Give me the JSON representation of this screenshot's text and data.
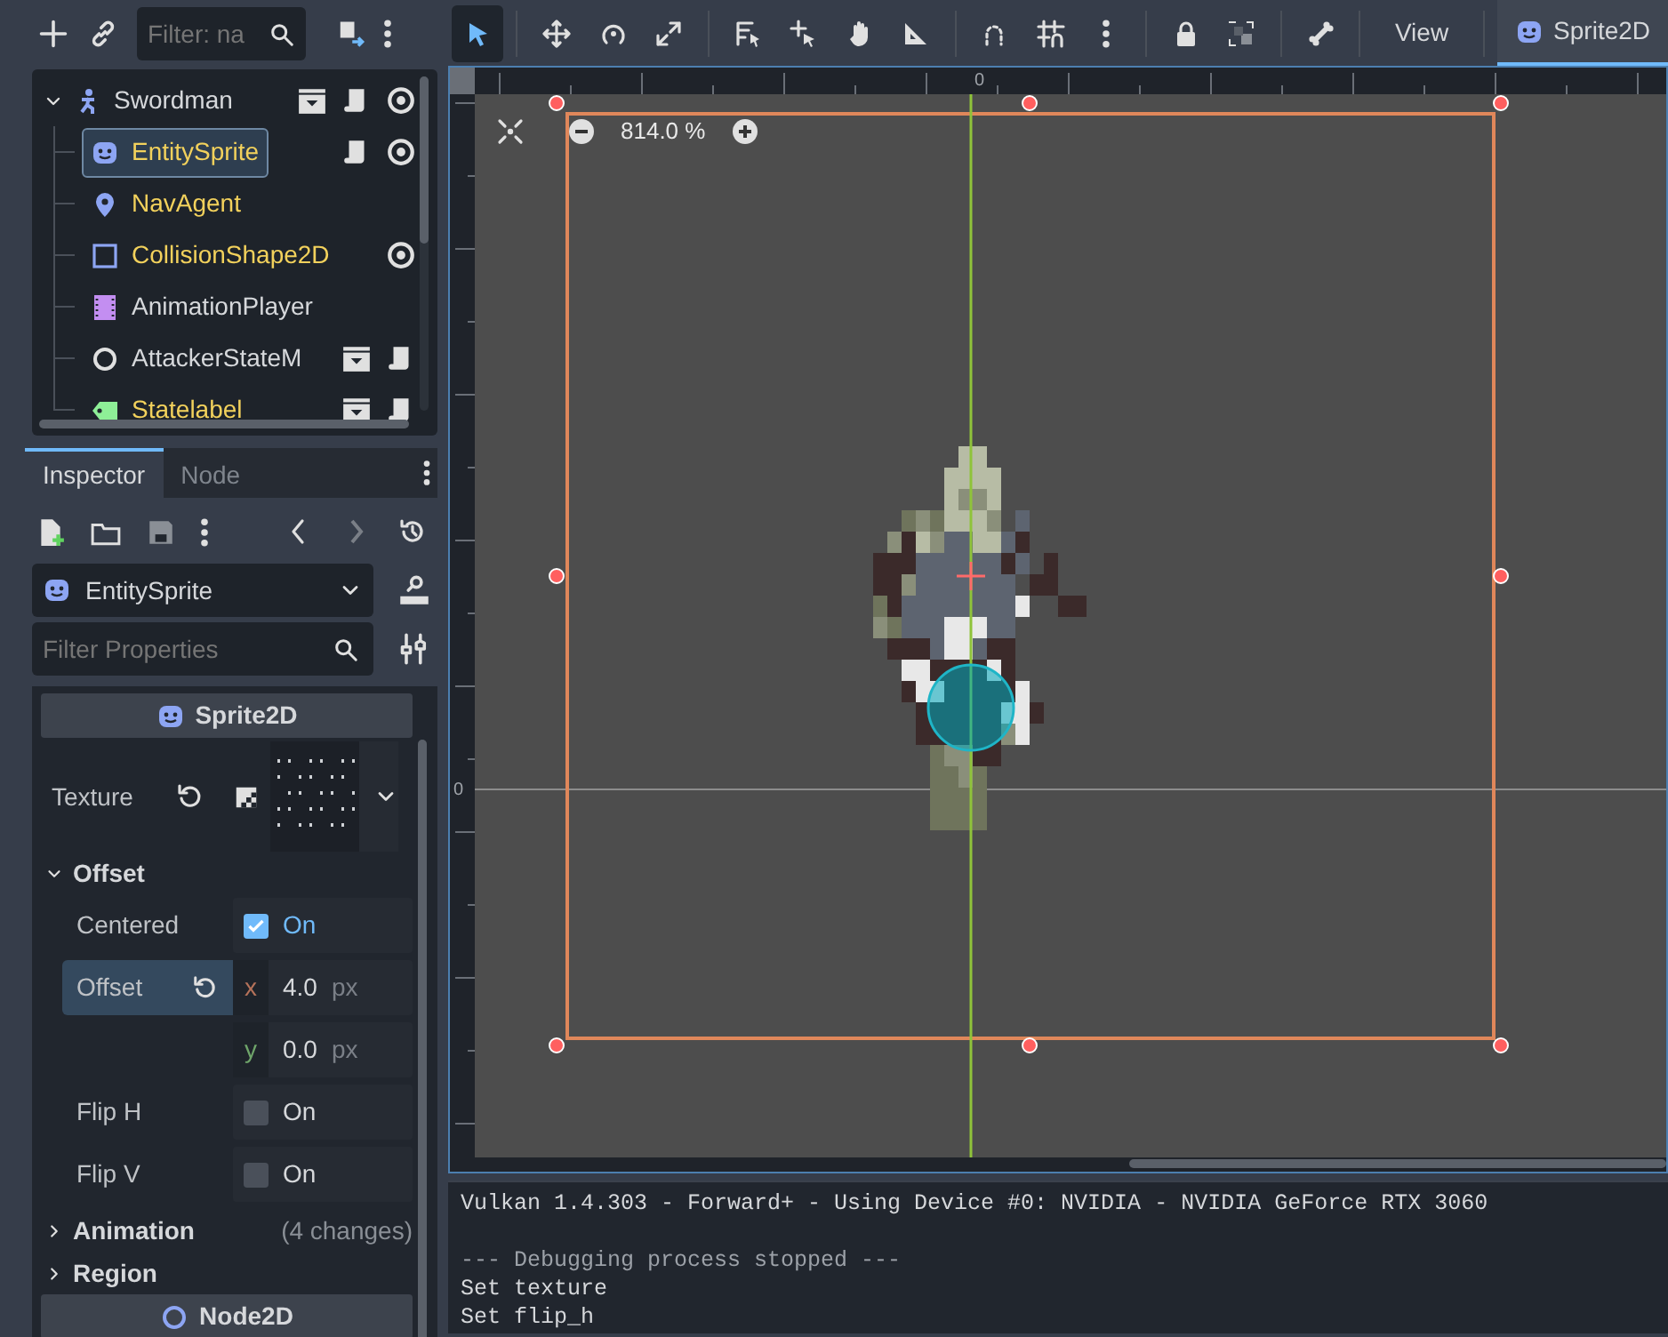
{
  "scene_dock": {
    "filter_placeholder": "Filter: na",
    "tree": {
      "label": "Swordman",
      "expanded": true,
      "selected": false,
      "color": "#d6d8db",
      "children": [
        {
          "label": "EntitySprite",
          "selected": true,
          "color": "#f2d15c"
        },
        {
          "label": "NavAgent",
          "selected": false,
          "color": "#f2d15c"
        },
        {
          "label": "CollisionShape2D",
          "selected": false,
          "color": "#f2d15c"
        },
        {
          "label": "AnimationPlayer",
          "selected": false,
          "color": "#d6d8db"
        },
        {
          "label": "AttackerStateM",
          "selected": false,
          "color": "#d6d8db"
        },
        {
          "label": "Statelabel",
          "selected": false,
          "color": "#f2d15c"
        }
      ]
    }
  },
  "inspector": {
    "tabs": [
      {
        "label": "Inspector",
        "selected": true
      },
      {
        "label": "Node",
        "selected": false
      }
    ],
    "object": "EntitySprite",
    "filter_placeholder": "Filter Properties",
    "properties": [
      {
        "kind": "class",
        "label": "Sprite2D"
      },
      {
        "kind": "texture",
        "label": "Texture"
      },
      {
        "kind": "group",
        "label": "Offset",
        "expanded": true
      },
      {
        "kind": "check",
        "label": "Centered",
        "checked": true,
        "value": "On"
      },
      {
        "kind": "vector",
        "label": "Offset",
        "selected": true,
        "components": [
          {
            "axis": "x",
            "value": "4.0",
            "unit": "px"
          },
          {
            "axis": "y",
            "value": "0.0",
            "unit": "px"
          }
        ]
      },
      {
        "kind": "check",
        "label": "Flip H",
        "checked": false,
        "value": "On"
      },
      {
        "kind": "check",
        "label": "Flip V",
        "checked": false,
        "value": "On"
      },
      {
        "kind": "group",
        "label": "Animation",
        "expanded": false,
        "note": "(4 changes)"
      },
      {
        "kind": "group",
        "label": "Region",
        "expanded": false
      },
      {
        "kind": "class",
        "label": "Node2D"
      }
    ]
  },
  "canvas_toolbar": {
    "tool_groups": [
      [
        {
          "selected": true
        }
      ],
      [
        {
          "selected": false
        },
        {
          "selected": false
        },
        {
          "selected": false
        }
      ],
      [
        {
          "selected": false
        },
        {
          "selected": false
        },
        {
          "selected": false
        },
        {
          "selected": false
        }
      ],
      [
        {
          "selected": false
        },
        {
          "selected": false
        },
        {
          "selected": false
        }
      ],
      [
        {
          "selected": false
        },
        {
          "selected": false
        }
      ],
      [
        {
          "selected": false
        }
      ]
    ],
    "view_menu": "View",
    "tab": {
      "label": "Sprite2D",
      "selected": true
    }
  },
  "viewport": {
    "ruler_top_label": "0",
    "ruler_left_label": "0",
    "zoom": "814.0 %"
  },
  "console": {
    "lines": [
      {
        "kind": "info",
        "text": "Vulkan 1.4.303 - Forward+ - Using Device #0: NVIDIA - NVIDIA GeForce RTX 3060"
      },
      {
        "kind": "separator",
        "text": "--- Debugging process stopped ---"
      },
      {
        "kind": "info",
        "text": "Set texture"
      },
      {
        "kind": "info",
        "text": "Set flip_h"
      }
    ]
  }
}
